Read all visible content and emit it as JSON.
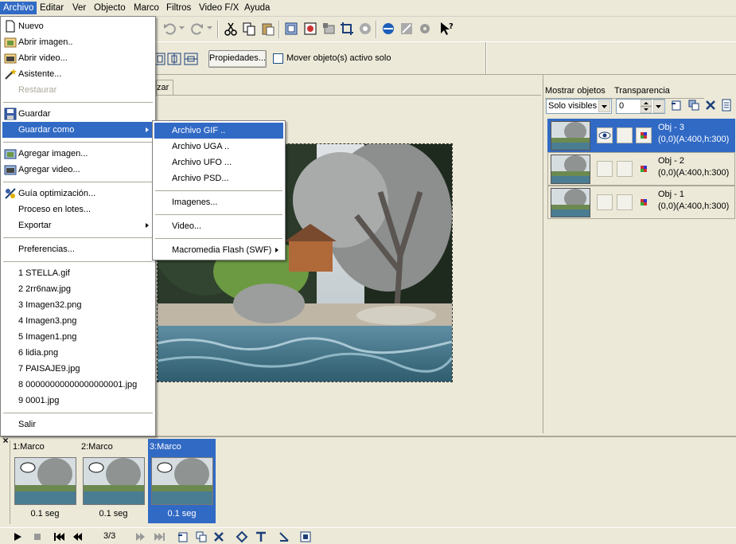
{
  "menubar": {
    "items": [
      "Archivo",
      "Editar",
      "Ver",
      "Objecto",
      "Marco",
      "Filtros",
      "Video F/X",
      "Ayuda"
    ]
  },
  "toolbar2": {
    "properties_button": "Propiedades...",
    "move_only_label": "Mover objeto(s) activo solo",
    "tab_fragment": "zar"
  },
  "right_panel": {
    "show_objects_label": "Mostrar objetos",
    "transparency_label": "Transparencia",
    "show_objects_value": "Solo visibles",
    "transparency_value": "0",
    "objects": [
      {
        "name": "Obj - 3",
        "dims": "(0,0)(A:400,h:300)",
        "selected": true,
        "visible": true
      },
      {
        "name": "Obj - 2",
        "dims": "(0,0)(A:400,h:300)",
        "selected": false,
        "visible": false
      },
      {
        "name": "Obj - 1",
        "dims": "(0,0)(A:400,h:300)",
        "selected": false,
        "visible": false
      }
    ]
  },
  "frames": {
    "items": [
      {
        "label": "1:Marco",
        "time": "0.1 seg",
        "selected": false
      },
      {
        "label": "2:Marco",
        "time": "0.1 seg",
        "selected": false
      },
      {
        "label": "3:Marco",
        "time": "0.1 seg",
        "selected": true
      }
    ],
    "counter": "3/3",
    "close_glyph": "×"
  },
  "file_menu": {
    "items": [
      {
        "label": "Nuevo",
        "icon": "new-file-icon"
      },
      {
        "label": "Abrir imagen..",
        "icon": "open-image-icon"
      },
      {
        "label": "Abrir video...",
        "icon": "open-video-icon"
      },
      {
        "label": "Asistente...",
        "icon": "wizard-icon"
      },
      {
        "label": "Restaurar",
        "disabled": true
      },
      {
        "label": "Guardar",
        "icon": "save-icon"
      },
      {
        "label": "Guardar como",
        "submenu": true,
        "highlighted": true
      },
      {
        "label": "Agregar imagen...",
        "icon": "add-image-icon"
      },
      {
        "label": "Agregar video...",
        "icon": "add-video-icon"
      },
      {
        "label": "Guía optimización...",
        "icon": "optimize-icon"
      },
      {
        "label": "Proceso en lotes..."
      },
      {
        "label": "Exportar",
        "submenu": true
      },
      {
        "label": "Preferencias..."
      },
      {
        "label": "1 STELLA.gif"
      },
      {
        "label": "2 2rr6naw.jpg"
      },
      {
        "label": "3 Imagen32.png"
      },
      {
        "label": "4 Imagen3.png"
      },
      {
        "label": "5 Imagen1.png"
      },
      {
        "label": "6 lidia.png"
      },
      {
        "label": "7 PAISAJE9.jpg"
      },
      {
        "label": "8 00000000000000000001.jpg"
      },
      {
        "label": "9 0001.jpg"
      },
      {
        "label": "Salir"
      }
    ]
  },
  "save_as_menu": {
    "items": [
      {
        "label": "Archivo GIF ..",
        "highlighted": true
      },
      {
        "label": "Archivo UGA .."
      },
      {
        "label": "Archivo UFO ..."
      },
      {
        "label": "Archivo PSD..."
      },
      {
        "label": "Imagenes..."
      },
      {
        "label": "Video..."
      },
      {
        "label": "Macromedia Flash (SWF)",
        "submenu": true
      }
    ]
  },
  "colors": {
    "highlight": "#316ac5",
    "face": "#ece9d8",
    "menu_bg": "#ffffff",
    "disabled": "#aca899"
  }
}
